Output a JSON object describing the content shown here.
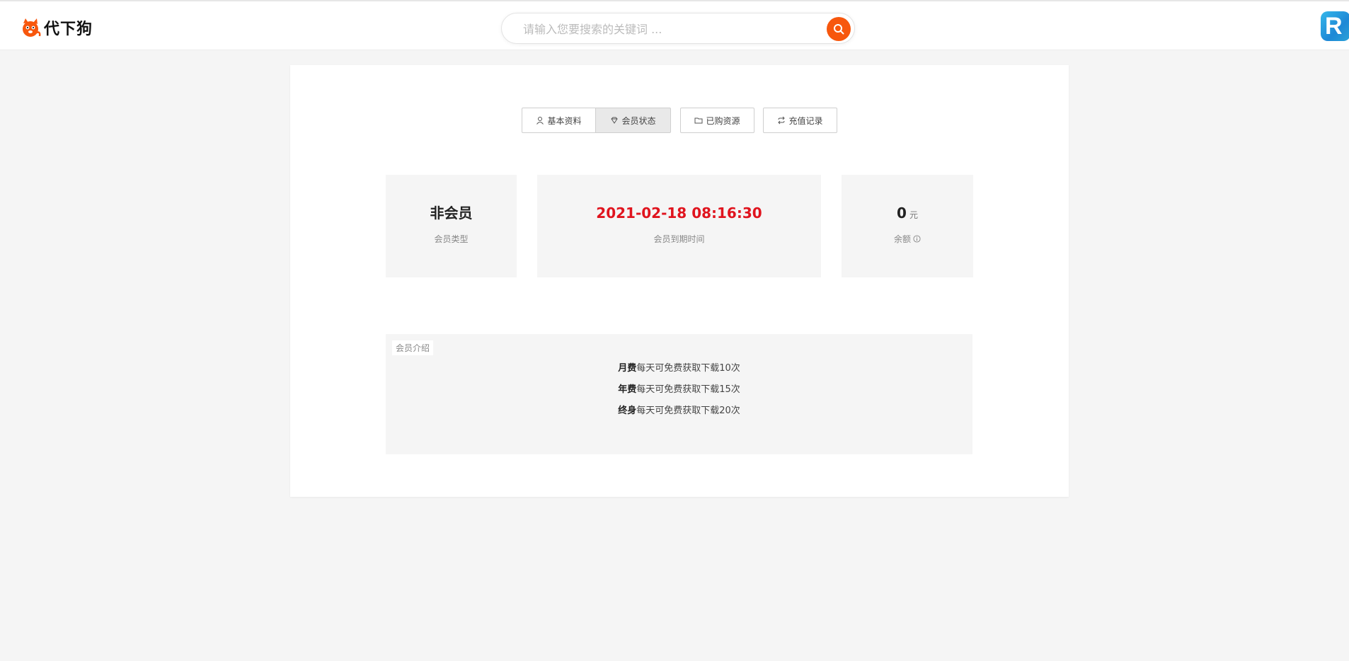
{
  "header": {
    "logo_text": "代下狗",
    "search_placeholder": "请输入您要搜索的关键词 ...",
    "avatar_letter": "R"
  },
  "tabs": [
    {
      "label": "基本资料",
      "icon": "user-icon",
      "active": false
    },
    {
      "label": "会员状态",
      "icon": "diamond-icon",
      "active": true
    },
    {
      "label": "已购资源",
      "icon": "folder-icon",
      "active": false
    },
    {
      "label": "充值记录",
      "icon": "exchange-icon",
      "active": false
    }
  ],
  "stats": {
    "member_type": {
      "value": "非会员",
      "label": "会员类型"
    },
    "expire": {
      "value": "2021-02-18 08:16:30",
      "label": "会员到期时间"
    },
    "balance": {
      "value": "0",
      "unit": "元",
      "label": "余额"
    }
  },
  "intro": {
    "title": "会员介绍",
    "lines": [
      {
        "plan": "月费",
        "desc": "每天可免费获取下载10次"
      },
      {
        "plan": "年费",
        "desc": "每天可免费获取下载15次"
      },
      {
        "plan": "终身",
        "desc": "每天可免费获取下载20次"
      }
    ]
  },
  "colors": {
    "accent": "#f7570d",
    "expire_text": "#e0141e",
    "background": "#f5f5f5"
  }
}
